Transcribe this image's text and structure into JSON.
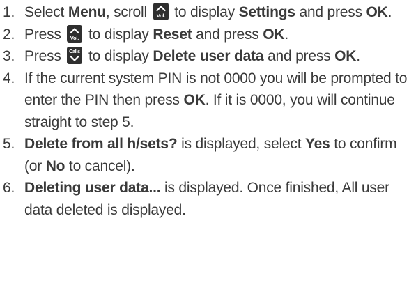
{
  "steps": [
    {
      "num": "1.",
      "parts": [
        {
          "t": "text",
          "v": "Select "
        },
        {
          "t": "bold",
          "v": "Menu"
        },
        {
          "t": "text",
          "v": ", scroll "
        },
        {
          "t": "key",
          "icon": "vol-up-key",
          "label": "Vol."
        },
        {
          "t": "text",
          "v": " to display "
        },
        {
          "t": "bold",
          "v": "Settings"
        },
        {
          "t": "text",
          "v": " and press "
        },
        {
          "t": "bold",
          "v": "OK"
        },
        {
          "t": "text",
          "v": "."
        }
      ]
    },
    {
      "num": "2.",
      "parts": [
        {
          "t": "text",
          "v": "Press "
        },
        {
          "t": "key",
          "icon": "vol-up-key",
          "label": "Vol."
        },
        {
          "t": "text",
          "v": " to display "
        },
        {
          "t": "bold",
          "v": "Reset"
        },
        {
          "t": "text",
          "v": " and press "
        },
        {
          "t": "bold",
          "v": "OK"
        },
        {
          "t": "text",
          "v": "."
        }
      ]
    },
    {
      "num": "3.",
      "parts": [
        {
          "t": "text",
          "v": "Press "
        },
        {
          "t": "key",
          "icon": "calls-down-key",
          "label": "Calls"
        },
        {
          "t": "text",
          "v": " to display "
        },
        {
          "t": "bold",
          "v": "Delete user data"
        },
        {
          "t": "text",
          "v": " and press "
        },
        {
          "t": "bold",
          "v": "OK"
        },
        {
          "t": "text",
          "v": "."
        }
      ]
    },
    {
      "num": "4.",
      "parts": [
        {
          "t": "text",
          "v": "If the current system PIN is not 0000 you will be prompted to enter the PIN then press "
        },
        {
          "t": "bold",
          "v": "OK"
        },
        {
          "t": "text",
          "v": ". If it is 0000, you will continue straight to step 5."
        }
      ]
    },
    {
      "num": "5.",
      "parts": [
        {
          "t": "bold",
          "v": "Delete from all h/sets?"
        },
        {
          "t": "text",
          "v": " is displayed, select "
        },
        {
          "t": "bold",
          "v": "Yes"
        },
        {
          "t": "text",
          "v": " to confirm (or "
        },
        {
          "t": "bold",
          "v": "No"
        },
        {
          "t": "text",
          "v": " to cancel)."
        }
      ]
    },
    {
      "num": "6.",
      "parts": [
        {
          "t": "bold",
          "v": "Deleting user data..."
        },
        {
          "t": "text",
          "v": " is displayed. Once finished, All user data deleted is displayed."
        }
      ]
    }
  ]
}
